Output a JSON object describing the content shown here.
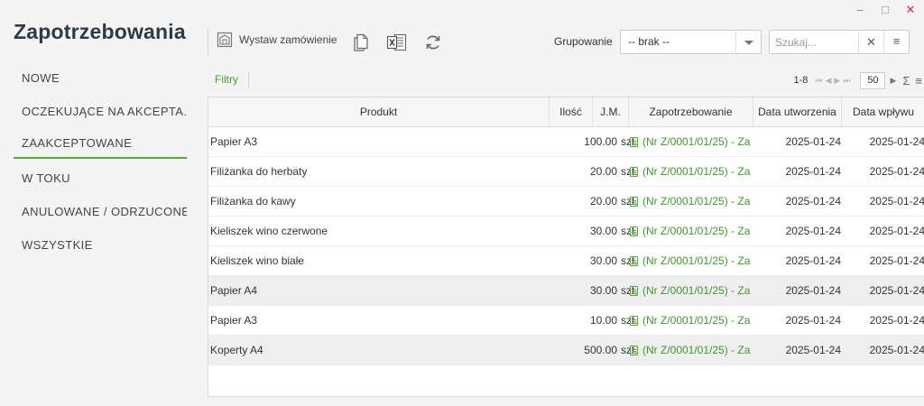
{
  "window": {
    "minimize": "–",
    "maximize": "□",
    "close": "✕"
  },
  "app_title": "Zapotrzebowania",
  "sidebar": {
    "items": [
      {
        "label": "NOWE"
      },
      {
        "label": "OCZEKUJĄCE NA AKCEPTA..."
      },
      {
        "label": "ZAAKCEPTOWANE",
        "active": true
      },
      {
        "label": "W TOKU"
      },
      {
        "label": "ANULOWANE / ODRZUCONE"
      },
      {
        "label": "WSZYSTKIE"
      }
    ]
  },
  "toolbar": {
    "order_button_label": "Wystaw zamówienie",
    "icons": [
      "warehouse-icon",
      "copy-document-icon",
      "excel-export-icon",
      "refresh-icon"
    ],
    "grouping_label": "Grupowanie",
    "grouping_value": "-- brak --",
    "search_placeholder": "Szukaj...",
    "search_clear": "✕",
    "search_menu": "≡"
  },
  "filter_bar": {
    "filters_label": "Filtry",
    "range": "1-8",
    "page_size": "50",
    "sigma": "Σ",
    "menu": "≡"
  },
  "grid": {
    "columns": {
      "product": "Produkt",
      "qty": "Ilość",
      "unit": "J.M.",
      "request": "Zapotrzebowanie",
      "created": "Data utworzenia",
      "received": "Data wpływu"
    },
    "rows": [
      {
        "product": "Papier A3",
        "qty": "100.00",
        "unit": "szt.",
        "request": "(Nr Z/0001/01/25) - Za",
        "created": "2025-01-24",
        "received": "2025-01-24"
      },
      {
        "product": "Filiżanka do herbaty",
        "qty": "20.00",
        "unit": "szt.",
        "request": "(Nr Z/0001/01/25) - Za",
        "created": "2025-01-24",
        "received": "2025-01-24"
      },
      {
        "product": "Filiżanka do kawy",
        "qty": "20.00",
        "unit": "szt.",
        "request": "(Nr Z/0001/01/25) - Za",
        "created": "2025-01-24",
        "received": "2025-01-24"
      },
      {
        "product": "Kieliszek wino czerwone",
        "qty": "30.00",
        "unit": "szt.",
        "request": "(Nr Z/0001/01/25) - Za",
        "created": "2025-01-24",
        "received": "2025-01-24"
      },
      {
        "product": "Kieliszek wino białe",
        "qty": "30.00",
        "unit": "szt.",
        "request": "(Nr Z/0001/01/25) - Za",
        "created": "2025-01-24",
        "received": "2025-01-24"
      },
      {
        "product": "Papier A4",
        "qty": "30.00",
        "unit": "szt.",
        "request": "(Nr Z/0001/01/25) - Za",
        "created": "2025-01-24",
        "received": "2025-01-24"
      },
      {
        "product": "Papier A3",
        "qty": "10.00",
        "unit": "szt.",
        "request": "(Nr Z/0001/01/25) - Za",
        "created": "2025-01-24",
        "received": "2025-01-24"
      },
      {
        "product": "Koperty A4",
        "qty": "500.00",
        "unit": "szt.",
        "request": "(Nr Z/0001/01/25) - Za",
        "created": "2025-01-24",
        "received": "2025-01-24"
      }
    ],
    "highlighted_rows": [
      5,
      7
    ]
  },
  "colors": {
    "accent": "#5aa83c",
    "link_green": "#3e9a2b",
    "close_red": "#d9362b"
  }
}
